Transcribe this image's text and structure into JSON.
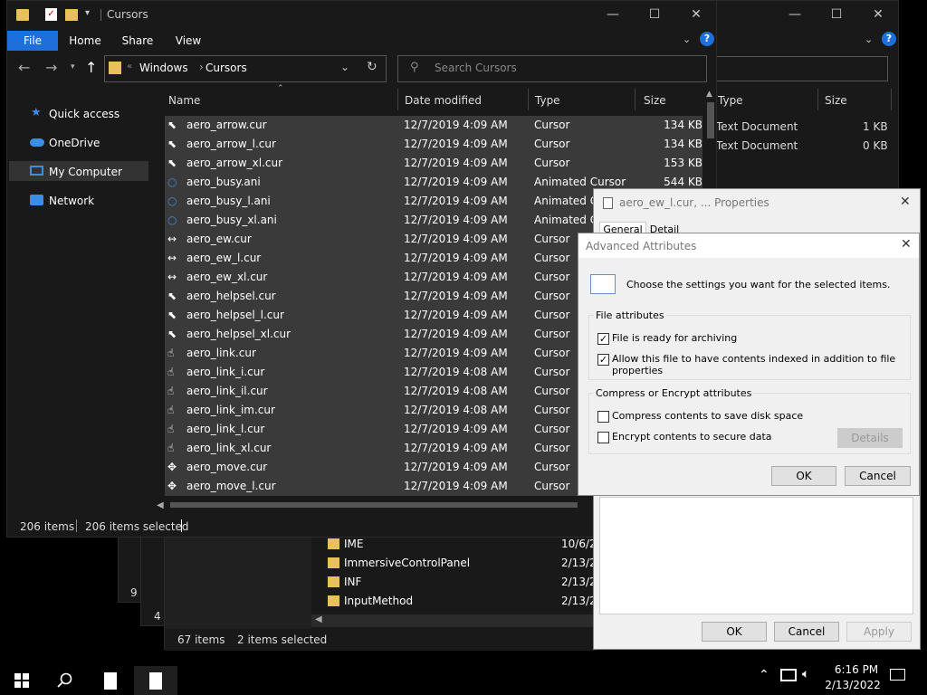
{
  "back_window": {
    "columns": {
      "type": "Type",
      "size": "Size"
    },
    "rows": [
      {
        "type": "Text Document",
        "size": "1 KB"
      },
      {
        "type": "Text Document",
        "size": "0 KB"
      }
    ],
    "status": "9 i",
    "status2": "4 i"
  },
  "windows_window": {
    "items": [
      {
        "name": "IME",
        "date": "10/6/2"
      },
      {
        "name": "ImmersiveControlPanel",
        "date": "2/13/2"
      },
      {
        "name": "INF",
        "date": "2/13/2"
      },
      {
        "name": "InputMethod",
        "date": "2/13/2"
      }
    ],
    "status_count": "67 items",
    "status_sel": "2 items selected"
  },
  "explorer": {
    "title": "Cursors",
    "tabs": {
      "file": "File",
      "home": "Home",
      "share": "Share",
      "view": "View"
    },
    "breadcrumb": {
      "prefix": "«",
      "parent": "Windows",
      "current": "Cursors"
    },
    "search_placeholder": "Search Cursors",
    "columns": {
      "name": "Name",
      "date": "Date modified",
      "type": "Type",
      "size": "Size"
    },
    "nav": [
      {
        "label": "Quick access",
        "icon": "star-icon"
      },
      {
        "label": "OneDrive",
        "icon": "cloud-icon"
      },
      {
        "label": "My Computer",
        "icon": "computer-icon"
      },
      {
        "label": "Network",
        "icon": "network-icon"
      }
    ],
    "files": [
      {
        "name": "aero_arrow.cur",
        "date": "12/7/2019 4:09 AM",
        "type": "Cursor",
        "size": "134 KB"
      },
      {
        "name": "aero_arrow_l.cur",
        "date": "12/7/2019 4:09 AM",
        "type": "Cursor",
        "size": "134 KB"
      },
      {
        "name": "aero_arrow_xl.cur",
        "date": "12/7/2019 4:09 AM",
        "type": "Cursor",
        "size": "153 KB"
      },
      {
        "name": "aero_busy.ani",
        "date": "12/7/2019 4:09 AM",
        "type": "Animated Cursor",
        "size": "544 KB"
      },
      {
        "name": "aero_busy_l.ani",
        "date": "12/7/2019 4:09 AM",
        "type": "Animated C",
        "size": ""
      },
      {
        "name": "aero_busy_xl.ani",
        "date": "12/7/2019 4:09 AM",
        "type": "Animated C",
        "size": ""
      },
      {
        "name": "aero_ew.cur",
        "date": "12/7/2019 4:09 AM",
        "type": "Cursor",
        "size": ""
      },
      {
        "name": "aero_ew_l.cur",
        "date": "12/7/2019 4:09 AM",
        "type": "Cursor",
        "size": ""
      },
      {
        "name": "aero_ew_xl.cur",
        "date": "12/7/2019 4:09 AM",
        "type": "Cursor",
        "size": ""
      },
      {
        "name": "aero_helpsel.cur",
        "date": "12/7/2019 4:09 AM",
        "type": "Cursor",
        "size": ""
      },
      {
        "name": "aero_helpsel_l.cur",
        "date": "12/7/2019 4:09 AM",
        "type": "Cursor",
        "size": ""
      },
      {
        "name": "aero_helpsel_xl.cur",
        "date": "12/7/2019 4:09 AM",
        "type": "Cursor",
        "size": ""
      },
      {
        "name": "aero_link.cur",
        "date": "12/7/2019 4:09 AM",
        "type": "Cursor",
        "size": ""
      },
      {
        "name": "aero_link_i.cur",
        "date": "12/7/2019 4:08 AM",
        "type": "Cursor",
        "size": ""
      },
      {
        "name": "aero_link_il.cur",
        "date": "12/7/2019 4:08 AM",
        "type": "Cursor",
        "size": ""
      },
      {
        "name": "aero_link_im.cur",
        "date": "12/7/2019 4:08 AM",
        "type": "Cursor",
        "size": ""
      },
      {
        "name": "aero_link_l.cur",
        "date": "12/7/2019 4:09 AM",
        "type": "Cursor",
        "size": ""
      },
      {
        "name": "aero_link_xl.cur",
        "date": "12/7/2019 4:09 AM",
        "type": "Cursor",
        "size": ""
      },
      {
        "name": "aero_move.cur",
        "date": "12/7/2019 4:09 AM",
        "type": "Cursor",
        "size": ""
      },
      {
        "name": "aero_move_l.cur",
        "date": "12/7/2019 4:09 AM",
        "type": "Cursor",
        "size": ""
      }
    ],
    "status_count": "206 items",
    "status_sel": "206 items selected"
  },
  "properties": {
    "title": "aero_ew_l.cur, ... Properties",
    "tab_general": "General",
    "tab_details": "Detail",
    "ok": "OK",
    "cancel": "Cancel",
    "apply": "Apply"
  },
  "advanced": {
    "title": "Advanced Attributes",
    "description": "Choose the settings you want for the selected items.",
    "group1": "File attributes",
    "archive": "File is ready for archiving",
    "index": "Allow this file to have contents indexed in addition to file properties",
    "group2": "Compress or Encrypt attributes",
    "compress": "Compress contents to save disk space",
    "encrypt": "Encrypt contents to secure data",
    "details": "Details",
    "ok": "OK",
    "cancel": "Cancel",
    "checks": {
      "archive": true,
      "index": true,
      "compress": false,
      "encrypt": false
    }
  },
  "taskbar": {
    "time": "6:16 PM",
    "date": "2/13/2022"
  }
}
